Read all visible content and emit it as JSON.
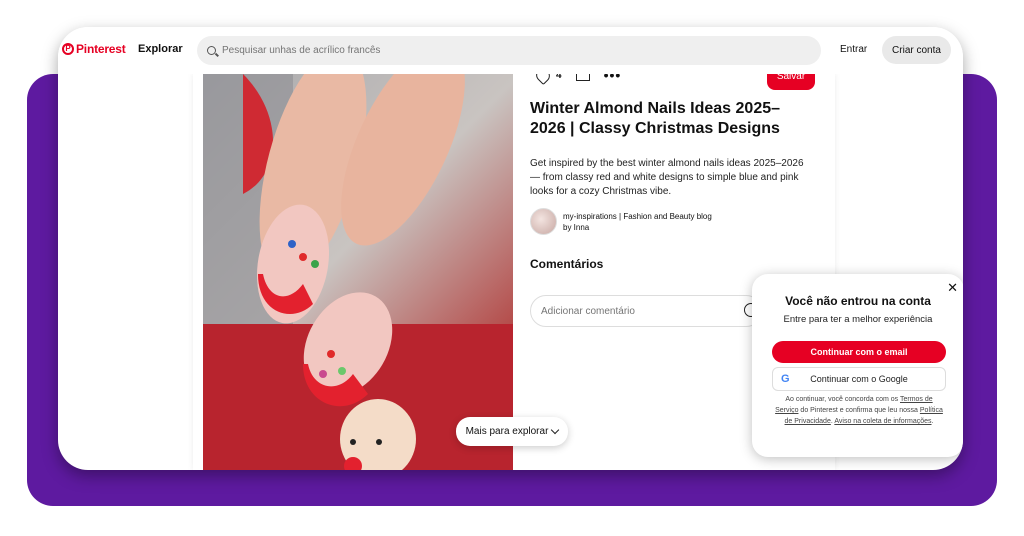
{
  "header": {
    "logo": "Pinterest",
    "explore": "Explorar",
    "search_placeholder": "Pesquisar unhas de acrílico francês",
    "login": "Entrar",
    "signup": "Criar conta"
  },
  "pin": {
    "like_count": "4",
    "save": "Salvar",
    "title": "Winter Almond Nails Ideas 2025–2026 | Classy Christmas Designs",
    "description": "Get inspired by the best winter almond nails ideas 2025–2026 — from classy red and white designs to simple blue and pink looks for a cozy Christmas vibe.",
    "author_line1": "my-inspirations | Fashion and Beauty blog",
    "author_line2": "by Inna",
    "comments_heading": "Comentários",
    "comment_placeholder": "Adicionar comentário"
  },
  "more_explore": "Mais para explorar",
  "login_popup": {
    "title": "Você não entrou na conta",
    "subtitle": "Entre para ter a melhor experiência",
    "email_button": "Continuar com o email",
    "google_button": "Continuar com o Google",
    "legal_prefix": "Ao continuar, você concorda com os",
    "terms": "Termos de Serviço",
    "legal_mid": "do Pinterest e confirma que leu nossa",
    "privacy": "Política de Privacidade",
    "legal_dot": ".",
    "notice": "Aviso na coleta de informações",
    "legal_end": "."
  },
  "colors": {
    "brand": "#e60023",
    "frame": "#5e1aa0"
  }
}
